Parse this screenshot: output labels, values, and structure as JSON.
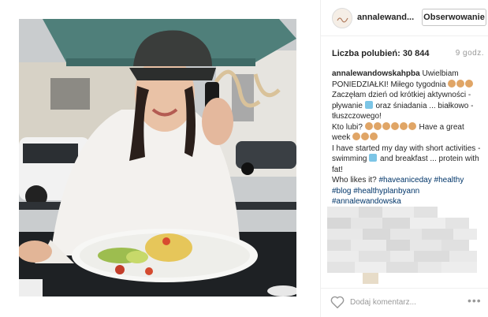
{
  "post": {
    "username": "annalewand...",
    "follow_label": "Obserwowanie",
    "likes_label": "Liczba polubień: 30 844",
    "time_ago": "9 godz.",
    "caption": {
      "user": "annalewandowskahpba",
      "line1": "Uwielbiam PONIEDZIAŁKI! Miłego tygodnia",
      "line2": "Zaczęłam dzień od krótkiej aktywności - pływanie",
      "line2b": "oraz śniadania ... białkowo - tłuszczowego!",
      "line3": "Kto lubi?",
      "line3b": "Have a great week",
      "line4": "I have started my day with short activities - swimming",
      "line4b": "and breakfast ... protein with fat!",
      "line5": "Who likes it?",
      "tags_line1": [
        "#haveaniceday",
        "#healthy"
      ],
      "tags_line2": [
        "#blog",
        "#healthyplanbyann"
      ],
      "tags_line3": [
        "#annalewandowska"
      ]
    },
    "comment_placeholder": "Dodaj komentarz...",
    "more_label": "•••"
  },
  "icons": {
    "heart": "heart-icon",
    "more": "more-options-icon",
    "emoji_muscle": "flexed-biceps-emoji",
    "emoji_swim": "swimming-pool-emoji"
  },
  "colors": {
    "hashtag": "#003569",
    "button_border": "#c5c5c5",
    "divider": "#efefef",
    "muted_text": "#999999"
  }
}
